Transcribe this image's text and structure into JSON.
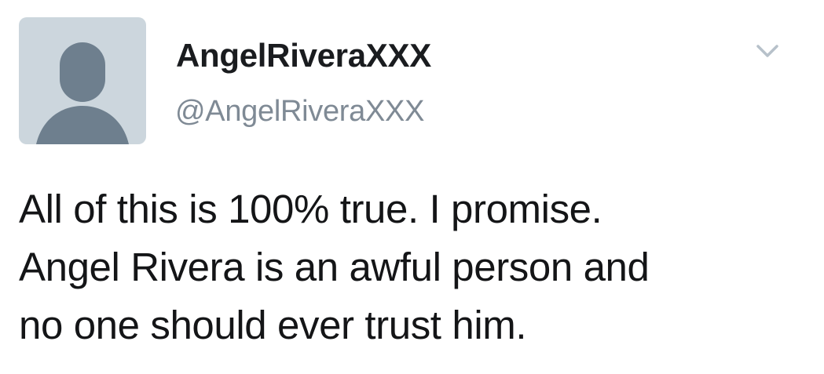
{
  "tweet": {
    "author": {
      "display_name": "AngelRiveraXXX",
      "handle": "@AngelRiveraXXX",
      "avatar_icon": "default-avatar-silhouette-icon"
    },
    "menu_icon": "chevron-down-icon",
    "text_lines": [
      "All of this is 100% true. I promise.",
      "Angel Rivera is an awful person and",
      "no one should ever trust him."
    ]
  },
  "colors": {
    "avatar_background": "#ccd6dd",
    "avatar_silhouette": "#6e7f8e",
    "display_name": "#1a1c1f",
    "handle": "#7f8a95",
    "chevron": "#b7c1ca",
    "tweet_text": "#141517"
  }
}
